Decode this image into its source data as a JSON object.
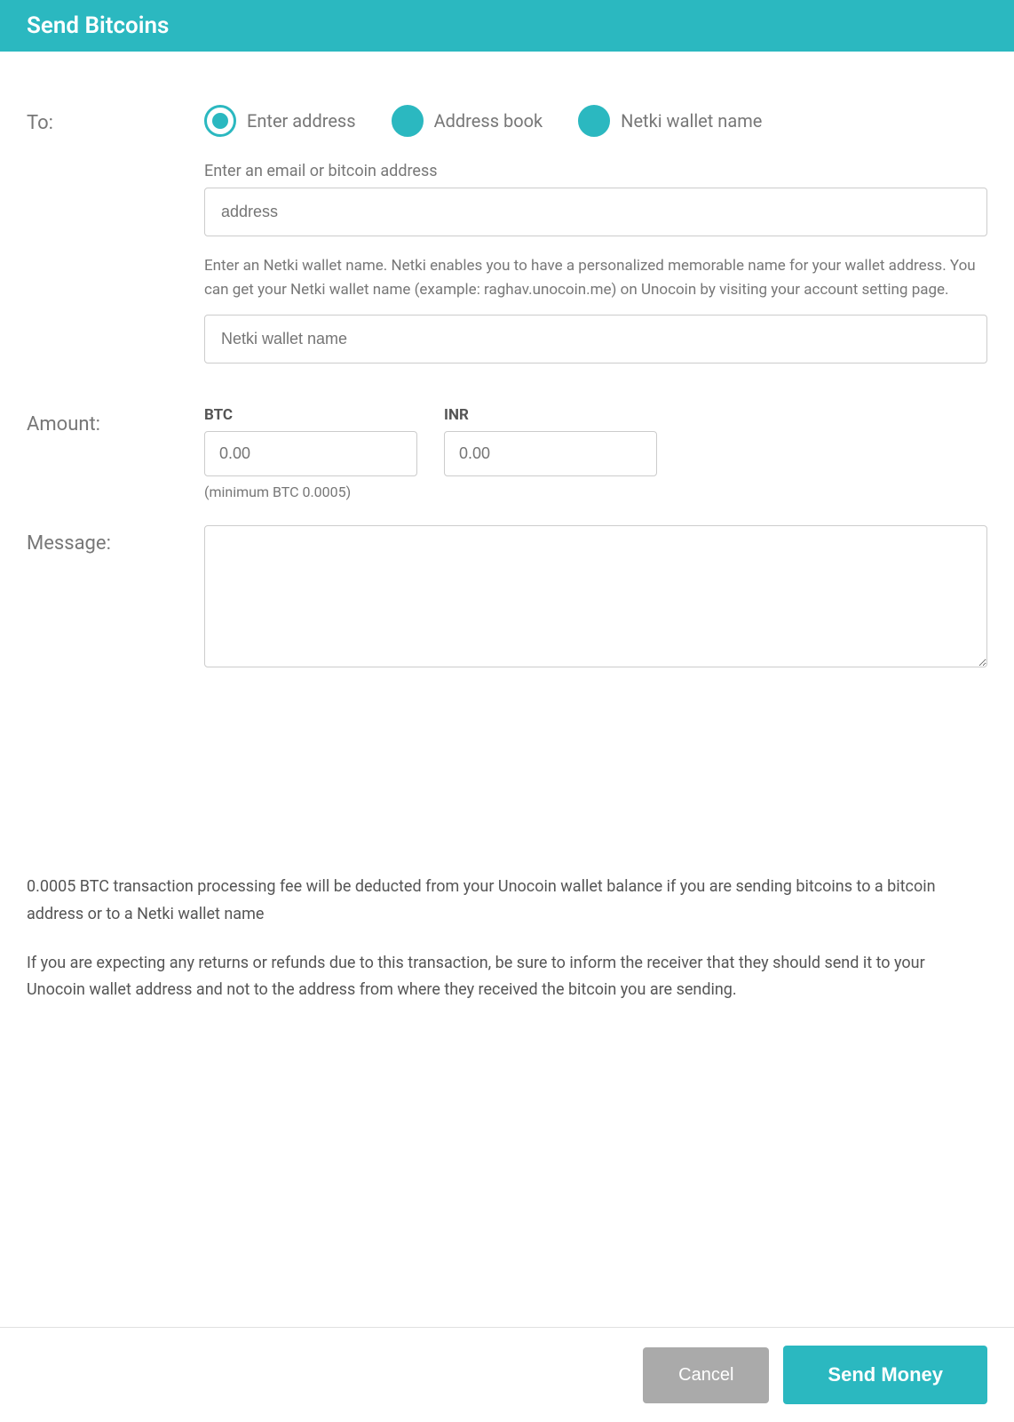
{
  "header": {
    "title": "Send Bitcoins"
  },
  "form": {
    "to_label": "To:",
    "amount_label": "Amount:",
    "message_label": "Message:",
    "radio_options": [
      {
        "id": "enter-address",
        "label": "Enter address",
        "selected": true,
        "filled": false
      },
      {
        "id": "address-book",
        "label": "Address book",
        "selected": false,
        "filled": true
      },
      {
        "id": "netki-wallet",
        "label": "Netki wallet name",
        "selected": false,
        "filled": true
      }
    ],
    "address_field_label": "Enter an email or bitcoin address",
    "address_placeholder": "address",
    "netki_description": "Enter an Netki wallet name. Netki enables you to have a personalized memorable name for your wallet address. You can get your Netki wallet name (example: raghav.unocoin.me) on Unocoin by visiting your account setting page.",
    "netki_placeholder": "Netki wallet name",
    "btc_label": "BTC",
    "inr_label": "INR",
    "btc_value": "0.00",
    "inr_value": "0.00",
    "minimum_note": "(minimum BTC 0.0005)",
    "message_placeholder": ""
  },
  "info": {
    "fee_notice": "0.0005 BTC transaction processing fee will be deducted from your Unocoin wallet balance if you are sending bitcoins to a bitcoin address or to a Netki wallet name",
    "refund_notice": "If you are expecting any returns or refunds due to this transaction, be sure to inform the receiver that they should send it to your Unocoin wallet address and not to the address from where they received the bitcoin you are sending."
  },
  "buttons": {
    "cancel": "Cancel",
    "send_money": "Send Money"
  }
}
